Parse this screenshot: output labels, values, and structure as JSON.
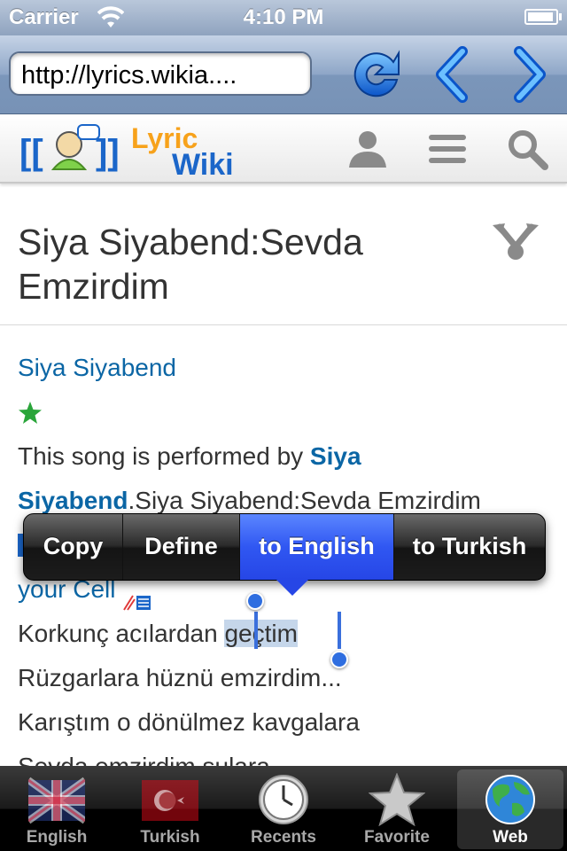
{
  "status_bar": {
    "carrier": "Carrier",
    "time": "4:10 PM"
  },
  "browser": {
    "url": "http://lyrics.wikia...."
  },
  "logo": {
    "bracket_left": "[[",
    "bracket_right": "]]",
    "word1": "Lyric",
    "word2": "Wiki"
  },
  "page": {
    "title": "Siya Siyabend:Sevda Emzirdim",
    "artist_link": "Siya Siyabend",
    "performed_prefix": "This song is performed by ",
    "performed_artist_a": "Siya",
    "performed_artist_b": "Siyabend",
    "performed_suffix": ".Siya Siyabend:Sevda Emzirdim",
    "ringtone_text": "your Cell",
    "lyric_line1_before": "Korkunç acılardan ",
    "lyric_line1_selected": "geçtim",
    "lyric_line2": "Rüzgarlara hüznü emzirdim...",
    "lyric_line3": "Karıştım o dönülmez kavgalara",
    "lyric_line4": "Sevda emzirdim sulara"
  },
  "edit_menu": {
    "copy": "Copy",
    "define": "Define",
    "to_english": "to English",
    "to_turkish": "to Turkish"
  },
  "tabs": [
    {
      "label": "English",
      "icon": "uk-flag-icon"
    },
    {
      "label": "Turkish",
      "icon": "turkey-flag-icon"
    },
    {
      "label": "Recents",
      "icon": "clock-icon"
    },
    {
      "label": "Favorite",
      "icon": "star-icon"
    },
    {
      "label": "Web",
      "icon": "globe-icon"
    }
  ],
  "active_tab": "Web",
  "colors": {
    "accent": "#2646e6",
    "link": "#0b66a5",
    "logo_orange": "#f7a21b",
    "logo_blue": "#1b66c9"
  }
}
